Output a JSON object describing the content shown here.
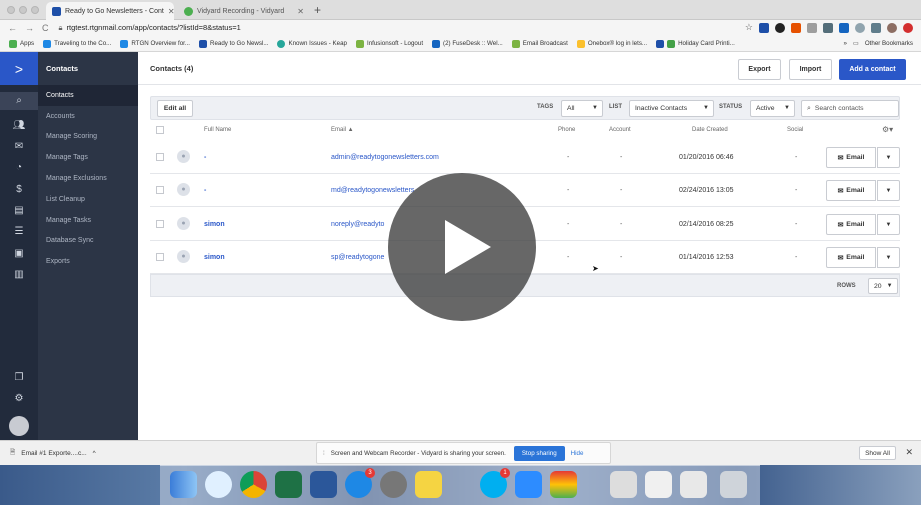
{
  "browser": {
    "tabs": [
      {
        "label": "Ready to Go Newsletters - Cont",
        "active": true
      },
      {
        "label": "Vidyard Recording - Vidyard",
        "active": false
      }
    ],
    "url": "rtgtest.rtgnmail.com/app/contacts/?listId=8&status=1",
    "bookmarks": [
      "Apps",
      "Traveling to the Co...",
      "RTGN Overview for...",
      "Ready to Go Newsl...",
      "Known Issues - Keap",
      "Infusionsoft - Logout",
      "(2) FuseDesk :: Wel...",
      "Email Broadcast",
      "Onebox® log in lets...",
      "Holiday Card Printi..."
    ],
    "other_bookmarks": "Other Bookmarks"
  },
  "subnav": {
    "header": "Contacts",
    "items": [
      "Contacts",
      "Accounts",
      "Manage Scoring",
      "Manage Tags",
      "Manage Exclusions",
      "List Cleanup",
      "Manage Tasks",
      "Database Sync",
      "Exports"
    ]
  },
  "topbar": {
    "title": "Contacts (4)",
    "export": "Export",
    "import": "Import",
    "add": "Add a contact"
  },
  "filters": {
    "edit_all": "Edit all",
    "tags_label": "TAGS",
    "tags_value": "All",
    "list_label": "LIST",
    "list_value": "Inactive Contacts",
    "status_label": "STATUS",
    "status_value": "Active",
    "search_placeholder": "Search contacts"
  },
  "table": {
    "headers": {
      "name": "Full Name",
      "email": "Email ▲",
      "phone": "Phone",
      "account": "Account",
      "date": "Date Created",
      "social": "Social"
    },
    "rows": [
      {
        "name": "-",
        "email": "admin@readytogonewsletters.com",
        "phone": "-",
        "account": "-",
        "date": "01/20/2016 06:46",
        "social": "-",
        "action": "Email"
      },
      {
        "name": "-",
        "email": "md@readytogonewsletters",
        "phone": "-",
        "account": "-",
        "date": "02/24/2016 13:05",
        "social": "-",
        "action": "Email"
      },
      {
        "name": "simon",
        "email": "noreply@readyto",
        "phone": "-",
        "account": "-",
        "date": "02/14/2016 08:25",
        "social": "-",
        "action": "Email"
      },
      {
        "name": "simon",
        "email": "sp@readytogone",
        "phone": "-",
        "account": "-",
        "date": "01/14/2016 12:53",
        "social": "-",
        "action": "Email"
      }
    ],
    "rows_label": "ROWS",
    "rows_value": "20"
  },
  "downloads": {
    "item": "Email #1 Exporte....c...",
    "share_text": "Screen and Webcam Recorder - Vidyard is sharing your screen.",
    "stop_sharing": "Stop sharing",
    "hide": "Hide",
    "show_all": "Show All"
  },
  "dock_badges": {
    "appstore": "3",
    "skype": "1"
  }
}
